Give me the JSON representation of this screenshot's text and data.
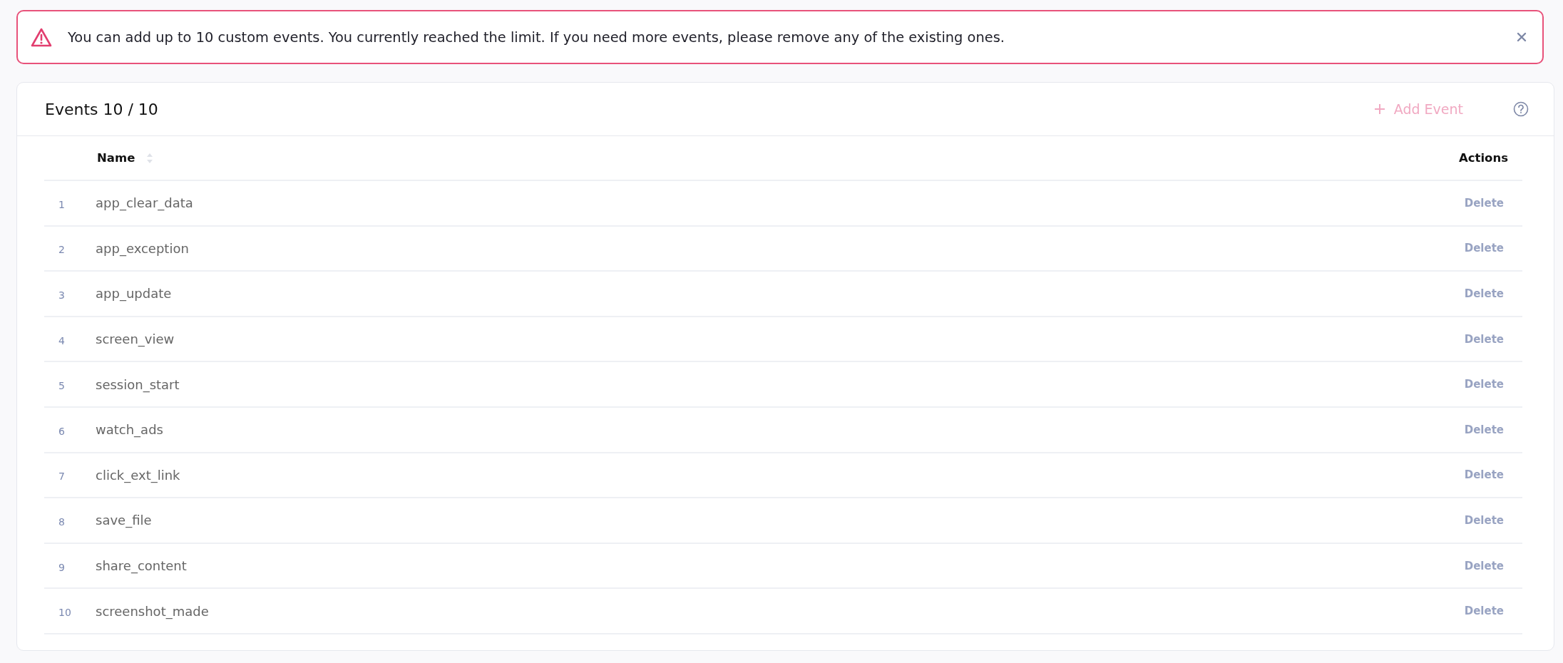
{
  "alert": {
    "message": "You can add up to 10 custom events. You currently reached the limit. If you need more events, please remove any of the existing ones."
  },
  "panel": {
    "title": "Events 10 / 10",
    "add_button": {
      "label": "Add Event",
      "disabled": true
    }
  },
  "table": {
    "columns": [
      "Name",
      "Actions"
    ],
    "rows": [
      {
        "number": "1",
        "name": "app_clear_data",
        "action": "Delete"
      },
      {
        "number": "2",
        "name": "app_exception",
        "action": "Delete"
      },
      {
        "number": "3",
        "name": "app_update",
        "action": "Delete"
      },
      {
        "number": "4",
        "name": "screen_view",
        "action": "Delete"
      },
      {
        "number": "5",
        "name": "session_start",
        "action": "Delete"
      },
      {
        "number": "6",
        "name": "watch_ads",
        "action": "Delete"
      },
      {
        "number": "7",
        "name": "click_ext_link",
        "action": "Delete"
      },
      {
        "number": "8",
        "name": "save_file",
        "action": "Delete"
      },
      {
        "number": "9",
        "name": "share_content",
        "action": "Delete"
      },
      {
        "number": "10",
        "name": "screenshot_made",
        "action": "Delete"
      }
    ]
  }
}
